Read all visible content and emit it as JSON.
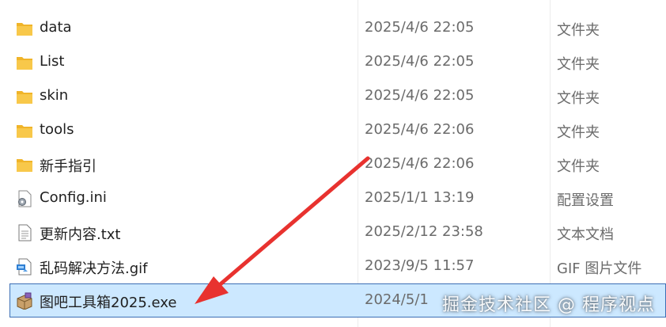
{
  "files": [
    {
      "name": "data",
      "date": "2025/4/6 22:05",
      "type": "文件夹",
      "icon": "folder-icon"
    },
    {
      "name": "List",
      "date": "2025/4/6 22:05",
      "type": "文件夹",
      "icon": "folder-icon"
    },
    {
      "name": "skin",
      "date": "2025/4/6 22:05",
      "type": "文件夹",
      "icon": "folder-icon"
    },
    {
      "name": "tools",
      "date": "2025/4/6 22:06",
      "type": "文件夹",
      "icon": "folder-icon"
    },
    {
      "name": "新手指引",
      "date": "2025/4/6 22:06",
      "type": "文件夹",
      "icon": "folder-icon"
    },
    {
      "name": "Config.ini",
      "date": "2025/1/1 13:19",
      "type": "配置设置",
      "icon": "config-file-icon"
    },
    {
      "name": "更新内容.txt",
      "date": "2025/2/12 23:58",
      "type": "文本文档",
      "icon": "text-file-icon"
    },
    {
      "name": "乱码解决方法.gif",
      "date": "2023/9/5 11:57",
      "type": "GIF 图片文件",
      "icon": "image-file-icon"
    },
    {
      "name": "图吧工具箱2025.exe",
      "date": "2024/5/1",
      "type": "",
      "icon": "app-package-icon",
      "selected": true
    }
  ],
  "watermark": "掘金技术社区 @ 程序视点",
  "colors": {
    "folder": "#f8c84a",
    "selection_bg": "#cce8ff",
    "selection_border": "#3d6fb5",
    "arrow": "#e8322f",
    "secondary_text": "#6b6b6b"
  }
}
